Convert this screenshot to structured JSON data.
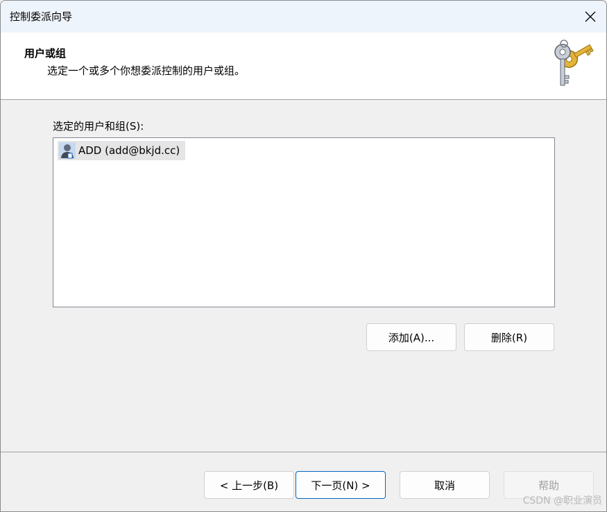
{
  "window": {
    "title": "控制委派向导",
    "close_icon": "close-icon"
  },
  "header": {
    "title": "用户或组",
    "subtitle": "选定一个或多个你想委派控制的用户或组。",
    "icon": "keys-icon"
  },
  "users_list": {
    "label": "选定的用户和组(S):",
    "items": [
      {
        "label": "ADD (add@bkjd.cc)",
        "icon": "user-icon"
      }
    ]
  },
  "list_buttons": {
    "add": "添加(A)...",
    "remove": "删除(R)"
  },
  "footer": {
    "back": "< 上一步(B)",
    "next": "下一页(N) >",
    "cancel": "取消",
    "help": "帮助"
  },
  "watermark": "CSDN @职业演员"
}
